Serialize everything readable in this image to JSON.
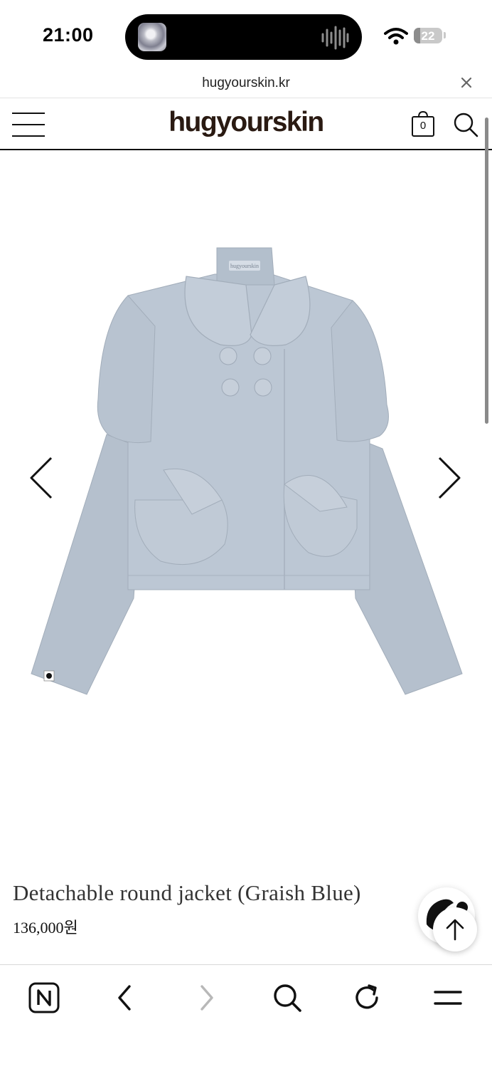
{
  "status_bar": {
    "time": "21:00",
    "battery": "22",
    "battery_level": 0.22
  },
  "browser": {
    "url": "hugyourskin.kr"
  },
  "site": {
    "logo": "hugyourskin",
    "cart_count": "0"
  },
  "product": {
    "name": "Detachable round jacket (Graish Blue)",
    "price": "136,000원",
    "label_tag": "hugyourskin"
  },
  "icons": {
    "close": "close-icon",
    "menu": "hamburger-menu-icon",
    "cart": "shopping-bag-icon",
    "search": "search-icon",
    "prev": "chevron-left-icon",
    "next": "chevron-right-icon",
    "top": "arrow-up-icon",
    "chat": "chat-icon",
    "naver": "naver-n-icon",
    "back": "back-icon",
    "forward": "forward-icon",
    "refresh": "refresh-icon",
    "browser_menu": "browser-menu-icon"
  },
  "colors": {
    "jacket": "#b9c4d1",
    "logo": "#2a1a12"
  }
}
